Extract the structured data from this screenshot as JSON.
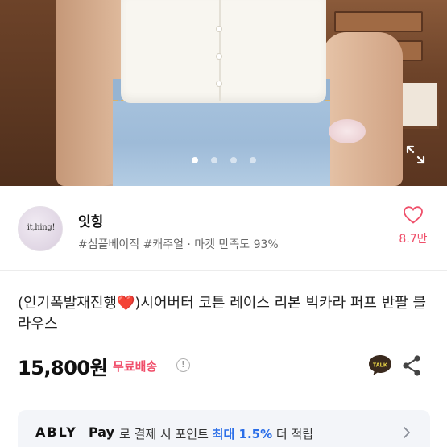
{
  "hero": {
    "slide_count": 4,
    "active_slide": 1
  },
  "seller": {
    "avatar_text": "it,hing!",
    "name": "잇힝",
    "tags": "#심플베이직 #캐주얼 · 마켓 만족도 93%",
    "like_count": "8.7만"
  },
  "product": {
    "title_prefix": "(인기폭발재진행",
    "title_emoji": "❤️",
    "title_suffix": ")시어버터 코튼 레이스 리본 빅카라 퍼프 반팔 블라우스",
    "price": "15,800원",
    "shipping": "무료배송",
    "info_glyph": "!",
    "talk_label": "TALK"
  },
  "banner": {
    "brand": "ABLY",
    "pay": "Pay",
    "text_before": "로 결제 시 포인트 ",
    "highlight": "최대 1.5%",
    "text_after": " 더 적립"
  },
  "colors": {
    "accent": "#f04e6a",
    "highlight": "#2b6ee8",
    "banner_bg": "#f3f5f9"
  },
  "icons": [
    "expand-icon",
    "heart-icon",
    "info-icon",
    "kakao-talk-icon",
    "share-icon",
    "chevron-right-icon"
  ]
}
